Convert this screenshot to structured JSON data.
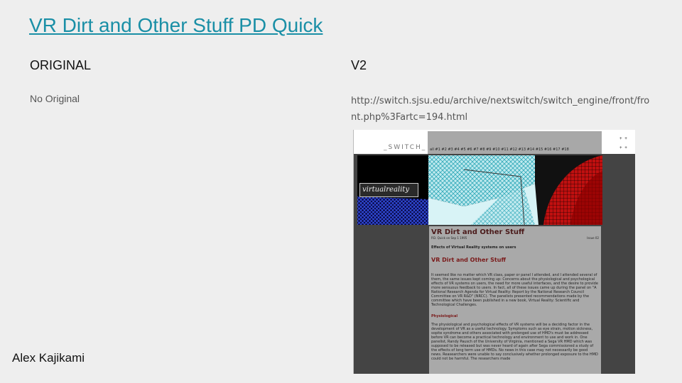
{
  "slide": {
    "title": "VR Dirt and Other Stuff PD Quick",
    "left_heading": "ORIGINAL",
    "right_heading": "V2",
    "left_text": "No Original",
    "url": "http://switch.sjsu.edu/archive/nextswitch/switch_engine/front/front.php%3Fartc=194.html",
    "author": "Alex Kajikami"
  },
  "screenshot": {
    "logo": "_SWITCH_",
    "issues_nav": "all #1 #2 #3 #4 #5 #6 #7 #8 #9 #10 #11 #12 #13 #14 #15 #16 #17 #18",
    "arrows": [
      "+ +",
      "+ +"
    ],
    "banner_label": "virtualreality",
    "article_title": "VR Dirt and Other Stuff",
    "byline": "P.D. Quick on Sep 1 1995",
    "issue": "Issue 02",
    "subtitle": "Effects of Virtual Reality systems on users",
    "heading": "VR Dirt and Other Stuff",
    "paragraph1": "It seemed like no matter which VR class, paper or panel I attended, and I attended several of them, the same issues kept coming up: Concerns about the physiological and psychological effects of VR systems on users, the need for more useful interfaces, and the desire to provide more sensuous feedback to users. In fact, all of these issues came up during the panel on \"A National Research Agenda for Virtual Reality: Report by the National Research Council Committee on VR R&D\" (NRCC). The panelists presented recommendations made by the committee which have been published in a new book, Virtual Reality: Scientific and Technological Challenges.",
    "section": "Physiological",
    "paragraph2": "The physiological and psychological effects of VR systems will be a deciding factor in the development of VR as a useful technology. Symptoms such as eye strain, motion sickness, sopite syndrome and others associated with prolonged use of HMD's must be addressed before VR can become a practical technology and environment to use and work in. One panelist, Randy Pausch of the University of Virginia, mentioned a Sega VR HMD which was supposed to be released but was never heard of again after Sega commissioned a study of the effects of long term use of HMDs. No news in this case may not necessarily be good news. Reasearchers were unable to say conclusively whether prolonged exposure to the HMD could not be harmful. The researchers made"
  }
}
